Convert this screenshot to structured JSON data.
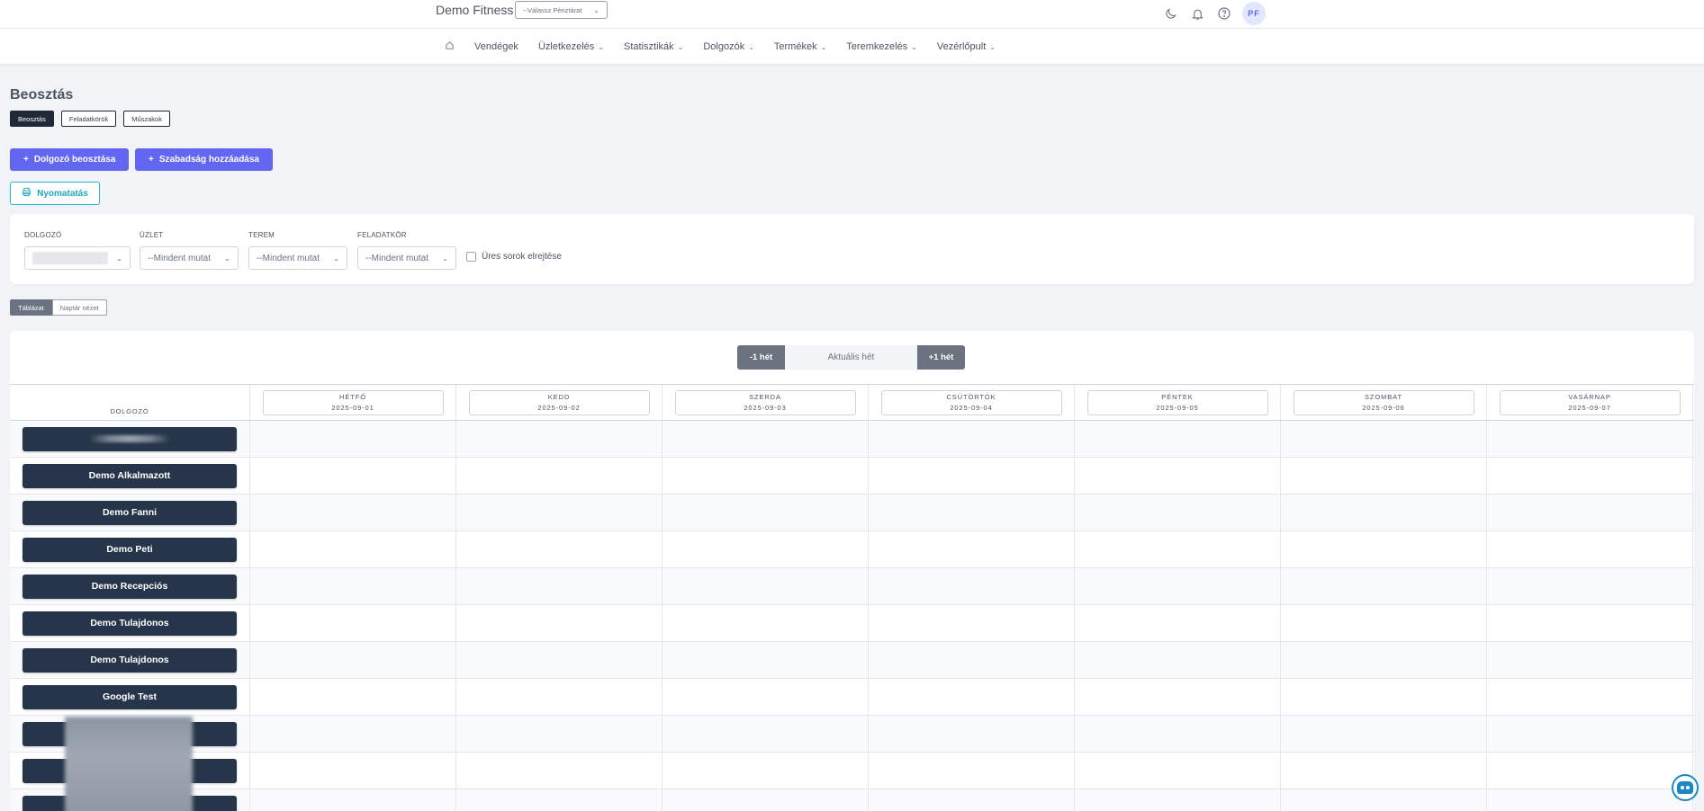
{
  "header": {
    "brand": "Demo Fitness",
    "register_select": "--Válassz Pénztárat",
    "avatar_initials": "PF",
    "icons": [
      "moon-icon",
      "bell-icon",
      "help-circle-icon"
    ]
  },
  "nav": {
    "home_icon": "home-icon",
    "items": [
      {
        "label": "Vendégek",
        "dropdown": false
      },
      {
        "label": "Üzletkezelés",
        "dropdown": true
      },
      {
        "label": "Statisztikák",
        "dropdown": true
      },
      {
        "label": "Dolgozók",
        "dropdown": true
      },
      {
        "label": "Termékek",
        "dropdown": true
      },
      {
        "label": "Teremkezelés",
        "dropdown": true
      },
      {
        "label": "Vezérlőpult",
        "dropdown": true
      }
    ]
  },
  "page": {
    "title": "Beosztás",
    "subtabs": [
      "Beosztás",
      "Feladatkörök",
      "Műszakok"
    ],
    "add_employee_btn": "Dolgozó beosztása",
    "add_leave_btn": "Szabadság hozzáadása",
    "print_btn": "Nyomatatás"
  },
  "filters": {
    "employee_label": "DOLGOZÓ",
    "shop_label": "ÜZLET",
    "shop_value": "--Mindent mutat",
    "room_label": "TEREM",
    "room_value": "--Mindent mutat",
    "role_label": "FELADATKÖR",
    "role_value": "--Mindent mutat",
    "hide_empty_label": "Üres sorok elrejtése"
  },
  "view_toggle": {
    "table": "Táblázat",
    "calendar": "Naptár nézet"
  },
  "week_nav": {
    "prev": "-1 hét",
    "current": "Aktuális hét",
    "next": "+1 hét"
  },
  "schedule": {
    "employee_header": "DOLGOZÓ",
    "days": [
      {
        "name": "HÉTFŐ",
        "date": "2025-09-01"
      },
      {
        "name": "KEDD",
        "date": "2025-09-02"
      },
      {
        "name": "SZERDA",
        "date": "2025-09-03"
      },
      {
        "name": "CSÜTÖRTÖK",
        "date": "2025-09-04"
      },
      {
        "name": "PÉNTEK",
        "date": "2025-09-05"
      },
      {
        "name": "SZOMBAT",
        "date": "2025-09-06"
      },
      {
        "name": "VASÁRNAP",
        "date": "2025-09-07"
      }
    ],
    "employees": [
      "",
      "Demo Alkalmazott",
      "Demo Fanni",
      "Demo Peti",
      "Demo Recepciós",
      "Demo Tulajdonos",
      "Demo Tulajdonos",
      "Google Test",
      "",
      "",
      ""
    ]
  }
}
